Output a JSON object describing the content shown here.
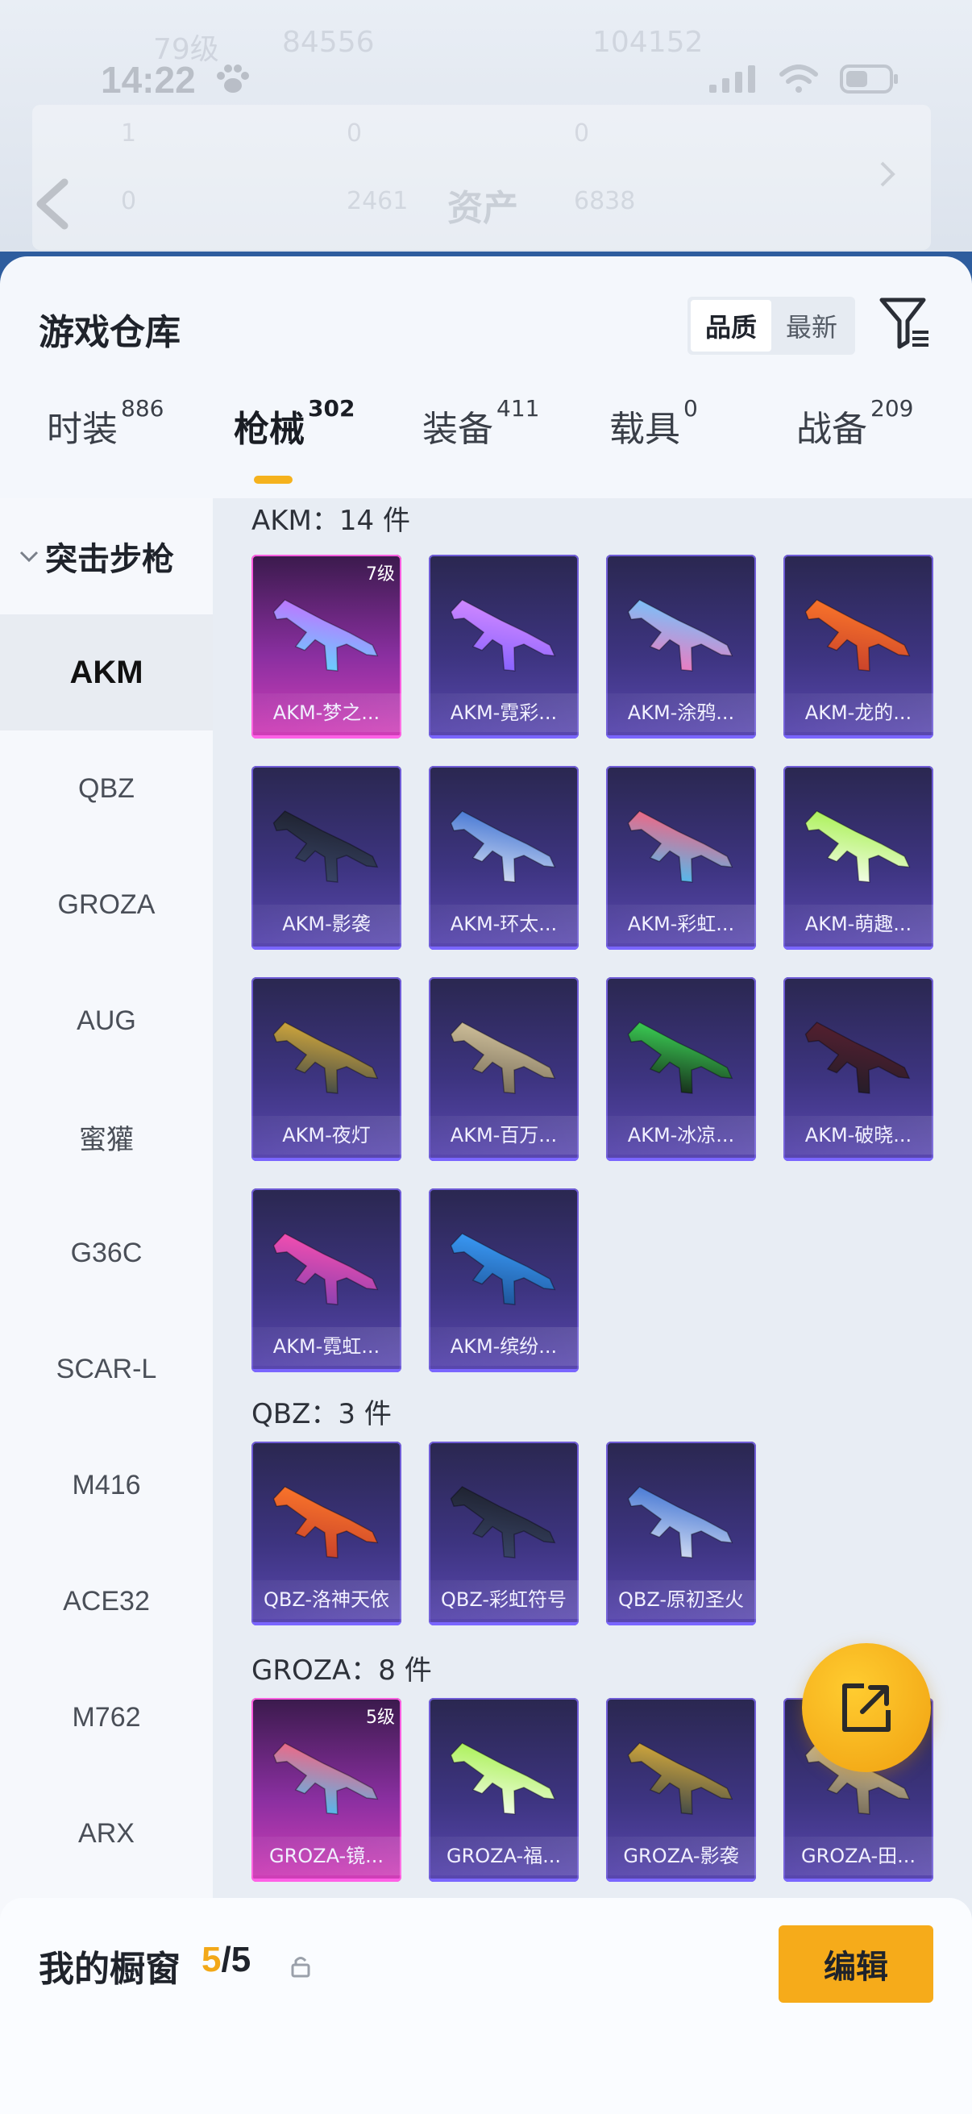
{
  "status_bar": {
    "time": "14:22"
  },
  "background": {
    "title": "资产",
    "faint_values": [
      "79级",
      "84556",
      "104152",
      "1",
      "0",
      "0",
      "0",
      "2461",
      "6838"
    ]
  },
  "sheet": {
    "title": "游戏仓库",
    "sort": {
      "quality": "品质",
      "newest": "最新",
      "selected": "品质"
    }
  },
  "tabs": [
    {
      "label": "时装",
      "count": "886",
      "active": false
    },
    {
      "label": "枪械",
      "count": "302",
      "active": true
    },
    {
      "label": "装备",
      "count": "411",
      "active": false
    },
    {
      "label": "载具",
      "count": "0",
      "active": false
    },
    {
      "label": "战备",
      "count": "209",
      "active": false
    }
  ],
  "sidebar": {
    "header": "突击步枪",
    "items": [
      "AKM",
      "QBZ",
      "GROZA",
      "AUG",
      "蜜獾",
      "G36C",
      "SCAR-L",
      "M416",
      "ACE32",
      "M762",
      "ARX"
    ],
    "active": "AKM"
  },
  "groups": [
    {
      "title": "AKM：14 件",
      "items": [
        {
          "name": "AKM-梦之...",
          "level": "7级",
          "rarity": "pink"
        },
        {
          "name": "AKM-霓彩..."
        },
        {
          "name": "AKM-涂鸦..."
        },
        {
          "name": "AKM-龙的..."
        },
        {
          "name": "AKM-影袭"
        },
        {
          "name": "AKM-环太..."
        },
        {
          "name": "AKM-彩虹..."
        },
        {
          "name": "AKM-萌趣..."
        },
        {
          "name": "AKM-夜灯"
        },
        {
          "name": "AKM-百万..."
        },
        {
          "name": "AKM-冰凉..."
        },
        {
          "name": "AKM-破晓..."
        },
        {
          "name": "AKM-霓虹..."
        },
        {
          "name": "AKM-缤纷..."
        }
      ]
    },
    {
      "title": "QBZ：3 件",
      "items": [
        {
          "name": "QBZ-洛神天依"
        },
        {
          "name": "QBZ-彩虹符号"
        },
        {
          "name": "QBZ-原初圣火"
        }
      ]
    },
    {
      "title": "GROZA：8 件",
      "items": [
        {
          "name": "GROZA-镜...",
          "level": "5级",
          "rarity": "pink"
        },
        {
          "name": "GROZA-福..."
        },
        {
          "name": "GROZA-影袭"
        },
        {
          "name": "GROZA-田..."
        }
      ]
    }
  ],
  "showcase": {
    "label": "我的橱窗",
    "current": "5",
    "total": "/5",
    "edit": "编辑"
  },
  "colors": {
    "accent": "#f6ab1a",
    "card": "#3d3480",
    "card_rare": "#d23fb8",
    "tab_underline": "#f5b21d"
  }
}
